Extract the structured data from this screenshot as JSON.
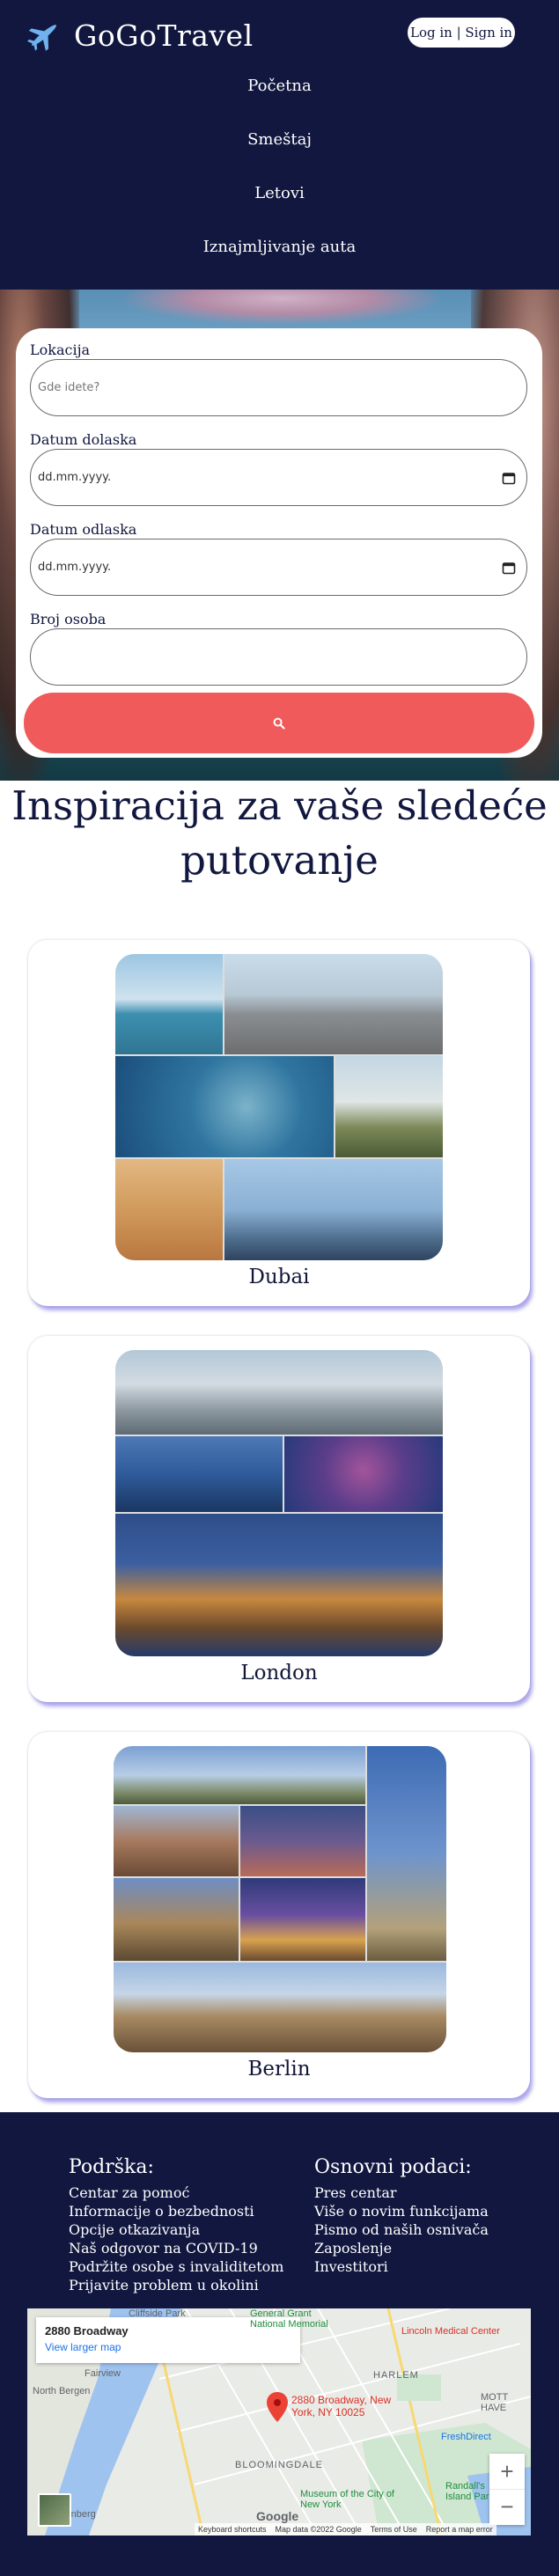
{
  "header": {
    "logo_text": "GoGoTravel",
    "login_label": "Log in | Sign in",
    "nav": [
      "Početna",
      "Smeštaj",
      "Letovi",
      "Iznajmljivanje auta"
    ]
  },
  "search": {
    "location_label": "Lokacija",
    "location_placeholder": "Gde idete?",
    "arrival_label": "Datum dolaska",
    "arrival_value": "dd.mm.yyyy.",
    "departure_label": "Datum odlaska",
    "departure_value": "dd.mm.yyyy.",
    "guests_label": "Broj osoba",
    "guests_value": ""
  },
  "inspiration": {
    "title": "Inspiracija za vaše sledeće putovanje",
    "cities": [
      {
        "name": "Dubai"
      },
      {
        "name": "London"
      },
      {
        "name": "Berlin"
      }
    ]
  },
  "footer": {
    "support_title": "Podrška:",
    "support_links": [
      "Centar za pomoć",
      "Informacije o bezbednosti",
      "Opcije otkazivanja",
      "Naš odgovor na COVID-19",
      "Podržite osobe s invaliditetom",
      "Prijavite problem u okolini"
    ],
    "basic_title": "Osnovni podaci:",
    "basic_links": [
      "Pres centar",
      "Više o novim funkcijama",
      "Pismo od naših osnivača",
      "Zaposlenje",
      "Investitori"
    ]
  },
  "map": {
    "place": "2880 Broadway",
    "larger_link": "View larger map",
    "pin_label": "2880 Broadway, New York, NY 10025",
    "labels": [
      "Cliffside Park",
      "Fairview",
      "North Bergen",
      "HARLEM",
      "BLOOMINGDALE",
      "Museum of the City of New York",
      "Lincoln Medical Center",
      "FreshDirect",
      "Randall's Island Park",
      "General Grant National Memorial",
      "Tenberg",
      "MOTT HAVE"
    ],
    "footer": [
      "Keyboard shortcuts",
      "Map data ©2022 Google",
      "Terms of Use",
      "Report a map error"
    ],
    "google": "Google"
  },
  "colors": {
    "navy": "#11173f",
    "coral": "#f05a5a",
    "card_shadow": "#6e64dc"
  }
}
